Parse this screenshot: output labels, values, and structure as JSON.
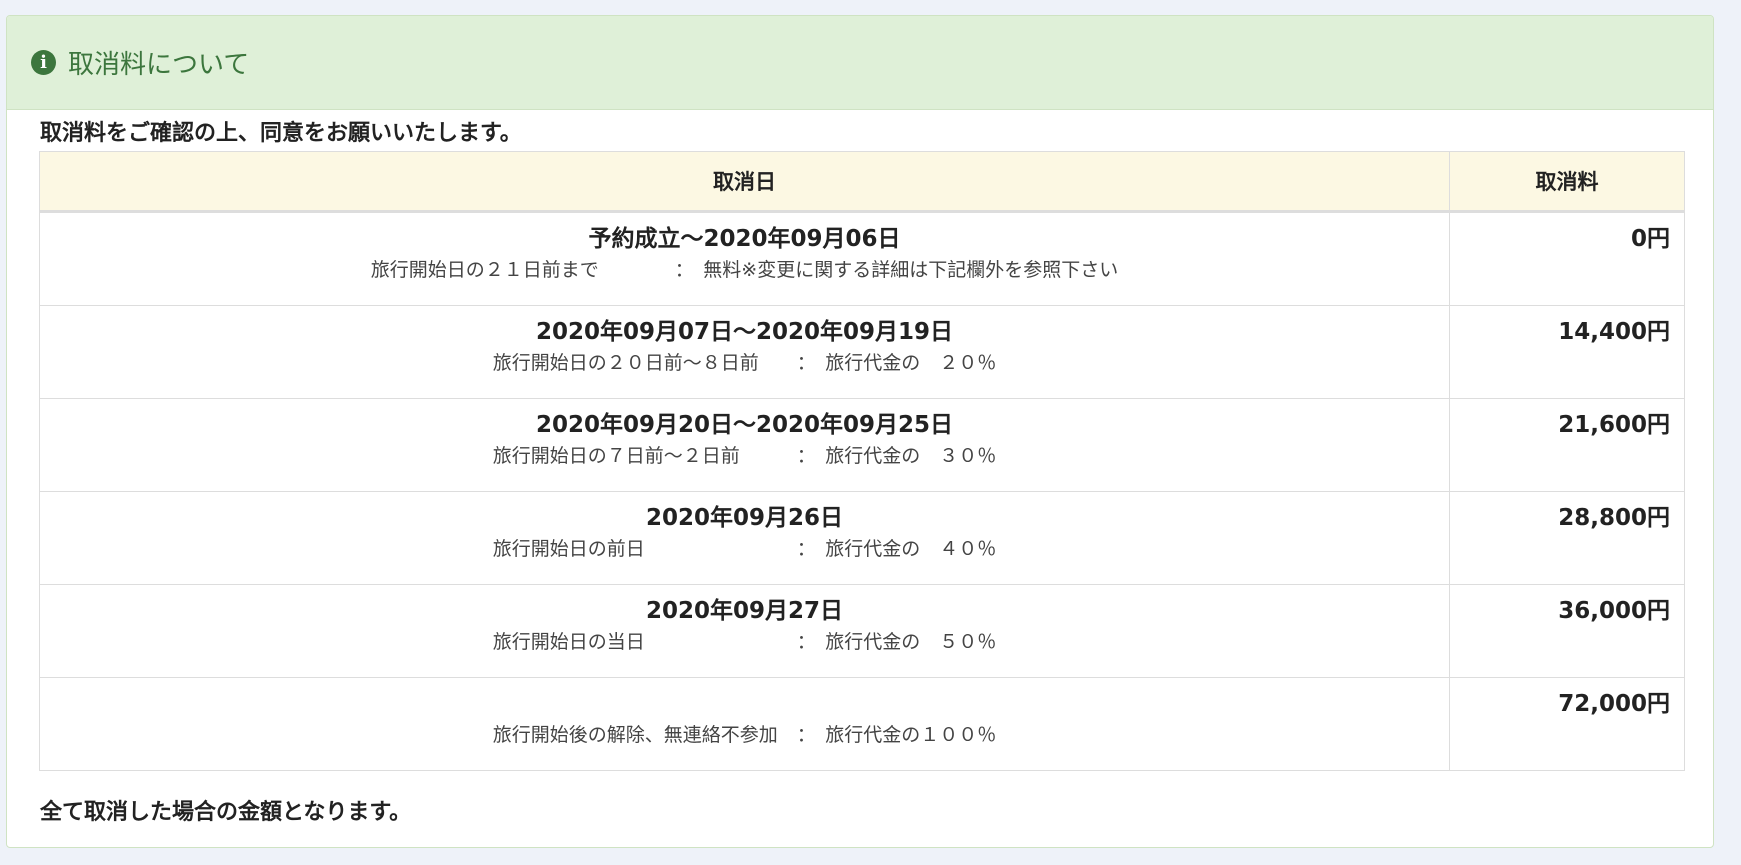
{
  "panel": {
    "title": "取消料について",
    "icon": "info-circle-icon"
  },
  "intro": "取消料をご確認の上、同意をお願いいたします。",
  "table": {
    "headers": [
      "取消日",
      "取消料"
    ],
    "rows": [
      {
        "period": "予約成立～2020年09月06日",
        "detail": "旅行開始日の２１日前まで　　　　：　無料※変更に関する詳細は下記欄外を参照下さい",
        "fee": "0円"
      },
      {
        "period": "2020年09月07日～2020年09月19日",
        "detail": "旅行開始日の２０日前～８日前　　：　旅行代金の　２０％",
        "fee": "14,400円"
      },
      {
        "period": "2020年09月20日～2020年09月25日",
        "detail": "旅行開始日の７日前～２日前　　　：　旅行代金の　３０％",
        "fee": "21,600円"
      },
      {
        "period": "2020年09月26日",
        "detail": "旅行開始日の前日　　　　　　　　：　旅行代金の　４０％",
        "fee": "28,800円"
      },
      {
        "period": "2020年09月27日",
        "detail": "旅行開始日の当日　　　　　　　　：　旅行代金の　５０％",
        "fee": "36,000円"
      },
      {
        "period": "",
        "detail": "旅行開始後の解除、無連絡不参加　：　旅行代金の１００％",
        "fee": "72,000円"
      }
    ]
  },
  "footer_note": "全て取消した場合の金額となります。",
  "colors": {
    "background": "#eef2f9",
    "heading_bg": "#dff0d8",
    "heading_text": "#3c763d",
    "table_header_bg": "#fcf8e3",
    "border": "#dddddd"
  }
}
